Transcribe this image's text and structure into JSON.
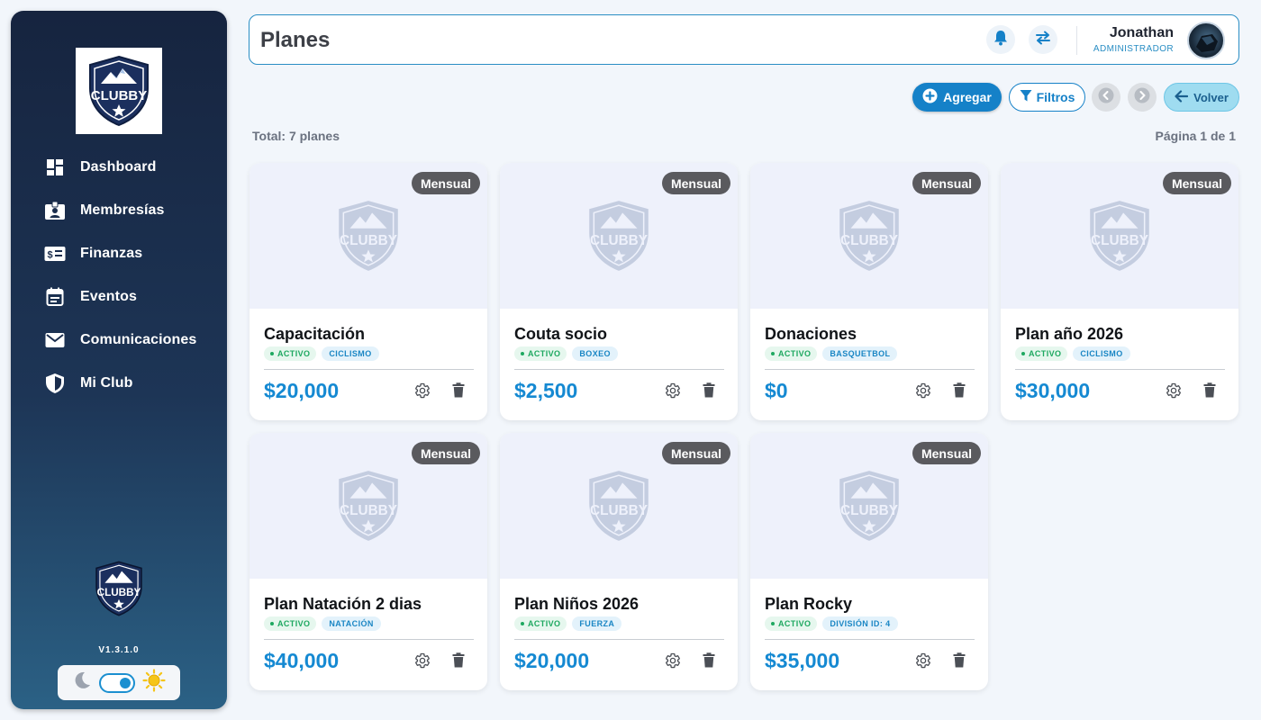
{
  "sidebar": {
    "logo_text": "CLUBBY",
    "items": [
      {
        "label": "Dashboard",
        "icon": "dashboard-icon"
      },
      {
        "label": "Membresías",
        "icon": "id-badge-icon"
      },
      {
        "label": "Finanzas",
        "icon": "money-icon"
      },
      {
        "label": "Eventos",
        "icon": "calendar-icon"
      },
      {
        "label": "Comunicaciones",
        "icon": "mail-icon"
      },
      {
        "label": "Mi Club",
        "icon": "shield-icon"
      }
    ],
    "version": "V1.3.1.0",
    "theme": {
      "dark_icon": "moon-icon",
      "light_icon": "sun-icon",
      "mode": "light"
    }
  },
  "header": {
    "title": "Planes",
    "user_name": "Jonathan",
    "user_role": "ADMINISTRADOR"
  },
  "toolbar": {
    "add_label": "Agregar",
    "filters_label": "Filtros",
    "back_label": "Volver"
  },
  "summary": {
    "total": "Total: 7 planes",
    "page": "Página 1 de 1"
  },
  "plans": [
    {
      "name": "Capacitación",
      "period": "Mensual",
      "status": "ACTIVO",
      "category": "CICLISMO",
      "price": "$20,000"
    },
    {
      "name": "Couta socio",
      "period": "Mensual",
      "status": "ACTIVO",
      "category": "BOXEO",
      "price": "$2,500"
    },
    {
      "name": "Donaciones",
      "period": "Mensual",
      "status": "ACTIVO",
      "category": "BASQUETBOL",
      "price": "$0"
    },
    {
      "name": "Plan año 2026",
      "period": "Mensual",
      "status": "ACTIVO",
      "category": "CICLISMO",
      "price": "$30,000"
    },
    {
      "name": "Plan Natación 2 dias",
      "period": "Mensual",
      "status": "ACTIVO",
      "category": "NATACIÓN",
      "price": "$40,000"
    },
    {
      "name": "Plan Niños 2026",
      "period": "Mensual",
      "status": "ACTIVO",
      "category": "FUERZA",
      "price": "$20,000"
    },
    {
      "name": "Plan Rocky",
      "period": "Mensual",
      "status": "ACTIVO",
      "category": "DIVISIÓN ID: 4",
      "price": "$35,000"
    }
  ],
  "colors": {
    "accent": "#1581c8",
    "price": "#1589d2",
    "status": "#1ea860",
    "sidebar_top": "#16243f",
    "sidebar_bottom": "#2b6185"
  }
}
